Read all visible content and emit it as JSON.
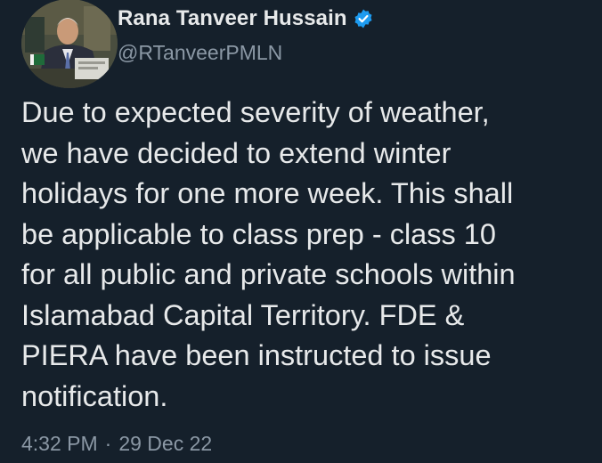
{
  "author": {
    "display_name": "Rana Tanveer Hussain",
    "handle": "@RTanveerPMLN",
    "verified": true,
    "avatar_icon": "profile-photo",
    "verified_icon": "verified-badge-icon"
  },
  "tweet": {
    "text": "Due to expected severity of weather,\nwe have decided to extend winter\nholidays for one more week. This shall\nbe applicable to class prep - class 10\nfor all public and private schools within\nIslamabad Capital Territory. FDE &\nPIERA have been instructed to issue\nnotification."
  },
  "meta": {
    "time": "4:32 PM",
    "separator": "·",
    "date": "29 Dec 22"
  },
  "colors": {
    "background": "#15202b",
    "text": "#e7e9ea",
    "secondary": "#8b98a5",
    "verified": "#1d9bf0"
  }
}
